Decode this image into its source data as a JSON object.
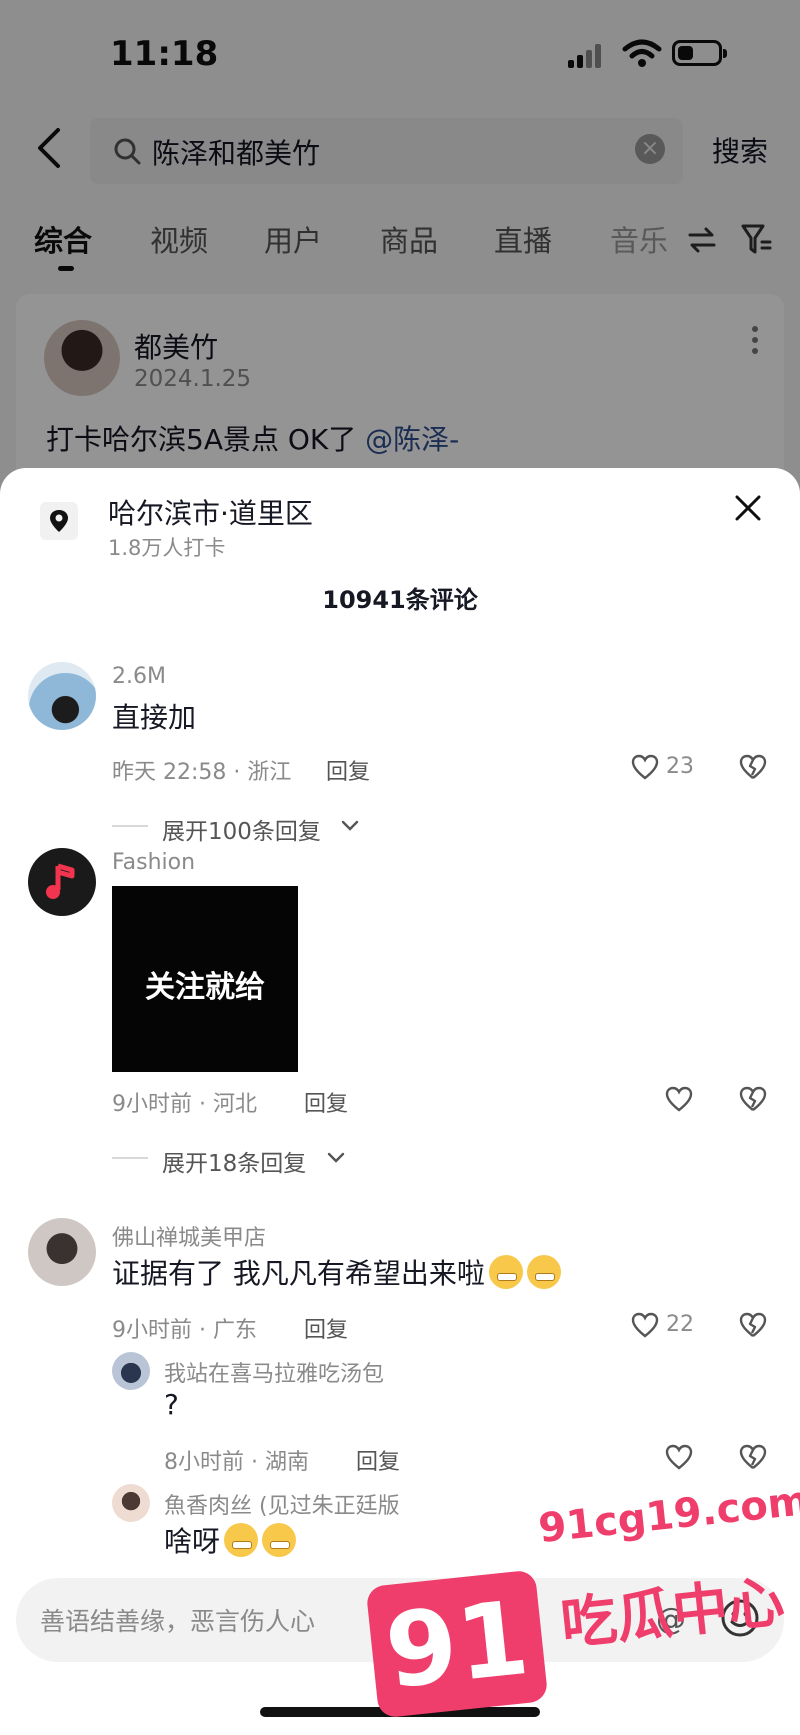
{
  "status_bar": {
    "time": "11:18",
    "battery_level": 0.4
  },
  "search": {
    "query": "陈泽和都美竹",
    "submit_label": "搜索"
  },
  "tabs": [
    {
      "label": "综合",
      "active": true
    },
    {
      "label": "视频"
    },
    {
      "label": "用户"
    },
    {
      "label": "商品"
    },
    {
      "label": "直播"
    },
    {
      "label": "音乐"
    }
  ],
  "result": {
    "author": "都美竹",
    "date": "2024.1.25",
    "text": "打卡哈尔滨5A景点 OK了 ",
    "mention": "@陈泽-"
  },
  "sheet": {
    "location_title": "哈尔滨市·道里区",
    "location_sub": "1.8万人打卡",
    "comment_count": "10941条评论"
  },
  "comments": [
    {
      "user": "2.6M",
      "text": "直接加",
      "meta": "昨天 22:58 · 浙江",
      "reply_label": "回复",
      "likes": "23",
      "expand": "展开100条回复"
    },
    {
      "user": "Fashion",
      "image_text": "关注就给",
      "meta": "9小时前 · 河北",
      "reply_label": "回复",
      "likes": "",
      "expand": "展开18条回复"
    },
    {
      "user": "佛山禅城美甲店",
      "text": "证据有了 我凡凡有希望出来啦",
      "meta": "9小时前 · 广东",
      "reply_label": "回复",
      "likes": "22"
    }
  ],
  "replies": [
    {
      "user": "我站在喜马拉雅吃汤包",
      "text": "?",
      "meta": "8小时前 · 湖南",
      "reply_label": "回复",
      "likes": ""
    },
    {
      "user": "魚香肉丝 (见过朱正廷版",
      "text": "啥呀"
    }
  ],
  "input": {
    "placeholder": "善语结善缘，恶言伤人心"
  },
  "watermark": {
    "badge": "91",
    "url": "91cg19.com",
    "name": "吃瓜中心"
  },
  "colors": {
    "accent_pink": "#ef3e6b",
    "mention_blue": "#2f4f8f",
    "muted_text": "#8a8a8a"
  }
}
